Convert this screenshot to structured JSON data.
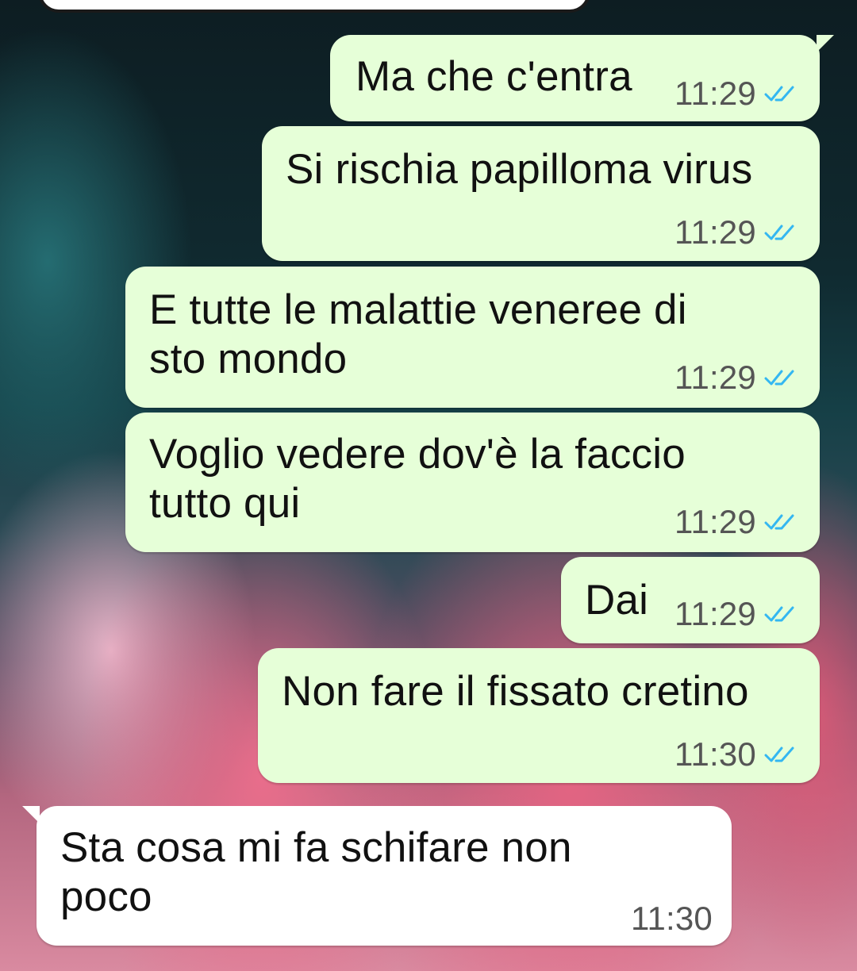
{
  "messages": [
    {
      "text": "Ma che c'entra",
      "time": "11:29",
      "direction": "outgoing",
      "status": "read"
    },
    {
      "text": "Si rischia papilloma virus",
      "time": "11:29",
      "direction": "outgoing",
      "status": "read"
    },
    {
      "text": "E tutte le malattie veneree di\nsto mondo",
      "time": "11:29",
      "direction": "outgoing",
      "status": "read"
    },
    {
      "text": "Voglio vedere dov'è la faccio\ntutto qui",
      "time": "11:29",
      "direction": "outgoing",
      "status": "read"
    },
    {
      "text": "Dai",
      "time": "11:29",
      "direction": "outgoing",
      "status": "read"
    },
    {
      "text": "Non fare il fissato cretino",
      "time": "11:30",
      "direction": "outgoing",
      "status": "read"
    },
    {
      "text": "Sta cosa mi fa schifare non\npoco",
      "time": "11:30",
      "direction": "incoming"
    }
  ],
  "colors": {
    "outgoing_bubble": "#e6ffd8",
    "incoming_bubble": "#ffffff",
    "read_tick": "#34b7f1"
  },
  "icons": {
    "read_receipt": "double-check-icon"
  }
}
